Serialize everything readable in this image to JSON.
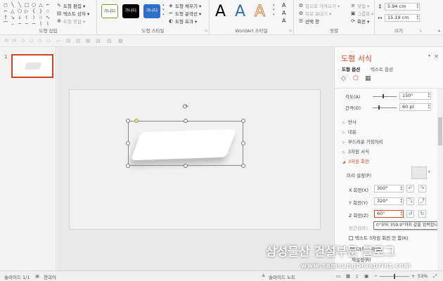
{
  "ribbon": {
    "shape_insert": {
      "label": "도형 삽입",
      "shapes": [
        "◻",
        "╲",
        "╲",
        "□",
        "○",
        "△",
        "⌐",
        "⌐",
        "△",
        "⬠",
        "▷",
        "{",
        "}",
        "☆",
        "↑",
        "↘",
        "↓",
        "(",
        ")",
        "☆",
        "∿",
        "⌒",
        "⌢",
        "~",
        "~",
        "~",
        "⌇",
        "⌇"
      ],
      "edit_label": "도형 편집 ▾",
      "textbox_label": "텍스트 상자 ▾",
      "merge_label": "도형 병합 ▾"
    },
    "shape_styles": {
      "label": "도형 스타일",
      "thumb_text": "가나다",
      "fill_label": "도형 채우기 ▾",
      "outline_label": "도형 윤곽선 ▾",
      "effects_label": "도형 효과 ▾",
      "thumb_colors": [
        "#ffffff",
        "#000000",
        "#2f6ec9"
      ]
    },
    "wordart": {
      "label": "WordArt 스타일",
      "letter": "A",
      "letter_colors": [
        "#000000",
        "#2e6fb5",
        "#e0782b"
      ]
    },
    "arrange": {
      "label": "정렬",
      "bring_forward": "앞으로 가져오기 ▾",
      "send_backward": "뒤로 보내기 ▾",
      "selection_pane": "선택 창",
      "align": "맞춤 ▾",
      "group": "그룹화 ▾",
      "rotate": "회전 ▾"
    },
    "size": {
      "label": "크기",
      "height": "5.94 cm",
      "width": "15.19 cm"
    }
  },
  "thumbnails": {
    "slide_number": "1"
  },
  "format_pane": {
    "title": "도형 서식",
    "tab_shape": "도형 옵션",
    "tab_text": "텍스트 옵션",
    "angle_label": "각도(A)",
    "angle_value": "150°",
    "spacing_label": "간격(D)",
    "spacing_value": "60 pt",
    "sections": [
      "반사",
      "네온",
      "부드러운 가장자리",
      "3차원 서식"
    ],
    "section_open": "3차원 회전",
    "preset_label": "미리 설정(P)",
    "x_label": "X 회전(X)",
    "x_value": "300°",
    "y_label": "Y 회전(Y)",
    "y_value": "320°",
    "z_label": "Z 회전(Z)",
    "z_value": "60°",
    "perspective_label": "원근감(E)",
    "tooltip": "0°부터 359.9°까지 값을 입력합니",
    "keep_flat_label": "텍스트 3차원 회전 안 함(K)",
    "distance_label": "지면과의 거리(D)",
    "reset_label": "재설정(R)"
  },
  "statusbar": {
    "slide_info": "슬라이드 1/1",
    "language": "한국어",
    "notes": "슬라이드 노트",
    "zoom": "53%"
  },
  "watermark": {
    "korean": "삼성물산 건설부문 블로그",
    "url": "www.samsungblueprint.com"
  }
}
